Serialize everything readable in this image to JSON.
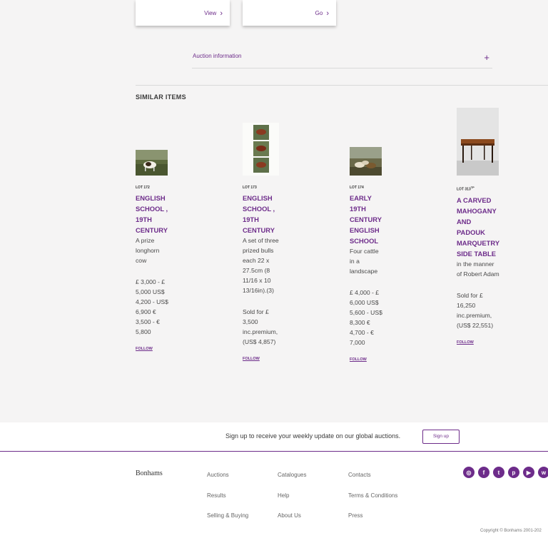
{
  "top_cards": [
    {
      "link_label": "View"
    },
    {
      "link_label": "Go"
    }
  ],
  "auction_info": {
    "label": "Auction information",
    "toggle": "+"
  },
  "similar": {
    "heading": "SIMILAR ITEMS",
    "items": [
      {
        "lot": "LOT 172",
        "lot_sup": "",
        "title": "ENGLISH SCHOOL , 19TH CENTURY",
        "desc": "A prize longhorn cow",
        "price": "£ 3,000 - £ 5,000 US$ 4,200 - US$ 6,900 € 3,500 - € 5,800",
        "follow": "FOLLOW"
      },
      {
        "lot": "LOT 173",
        "lot_sup": "",
        "title": "ENGLISH SCHOOL , 19TH CENTURY",
        "desc": "A set of three prized bulls each 22 x 27.5cm (8 11/16 x 10 13/16in).(3)",
        "price": "Sold for £ 3,500 inc.premium, (US$ 4,857)",
        "follow": "FOLLOW"
      },
      {
        "lot": "LOT 174",
        "lot_sup": "",
        "title": "EARLY 19TH CENTURY ENGLISH SCHOOL",
        "desc": "Four cattle in a landscape",
        "price": "£ 4,000 - £ 6,000 US$ 5,600 - US$ 8,300 € 4,700 - € 7,000",
        "follow": "FOLLOW"
      },
      {
        "lot": "LOT 313",
        "lot_sup": "TP",
        "title": "A CARVED MAHOGANY AND PADOUK MARQUETRY SIDE TABLE",
        "desc": "in the manner of Robert Adam",
        "price": "Sold for £ 16,250 inc.premium, (US$ 22,551)",
        "follow": "FOLLOW"
      }
    ]
  },
  "signup": {
    "text": "Sign up to receive your weekly update on our global auctions.",
    "button": "Sign up"
  },
  "footer": {
    "logo": "Bonhams",
    "col1": [
      "Auctions",
      "Results",
      "Selling & Buying"
    ],
    "col2": [
      "Catalogues",
      "Help",
      "About Us"
    ],
    "col3": [
      "Contacts",
      "Terms & Conditions",
      "Press"
    ],
    "socials": [
      "instagram-icon",
      "facebook-icon",
      "twitter-icon",
      "pinterest-icon",
      "youtube-icon",
      "wechat-icon"
    ],
    "copyright": "Copyright © Bonhams 2001-202"
  },
  "colors": {
    "accent": "#6d2c8a",
    "background": "#f5f4f4"
  }
}
